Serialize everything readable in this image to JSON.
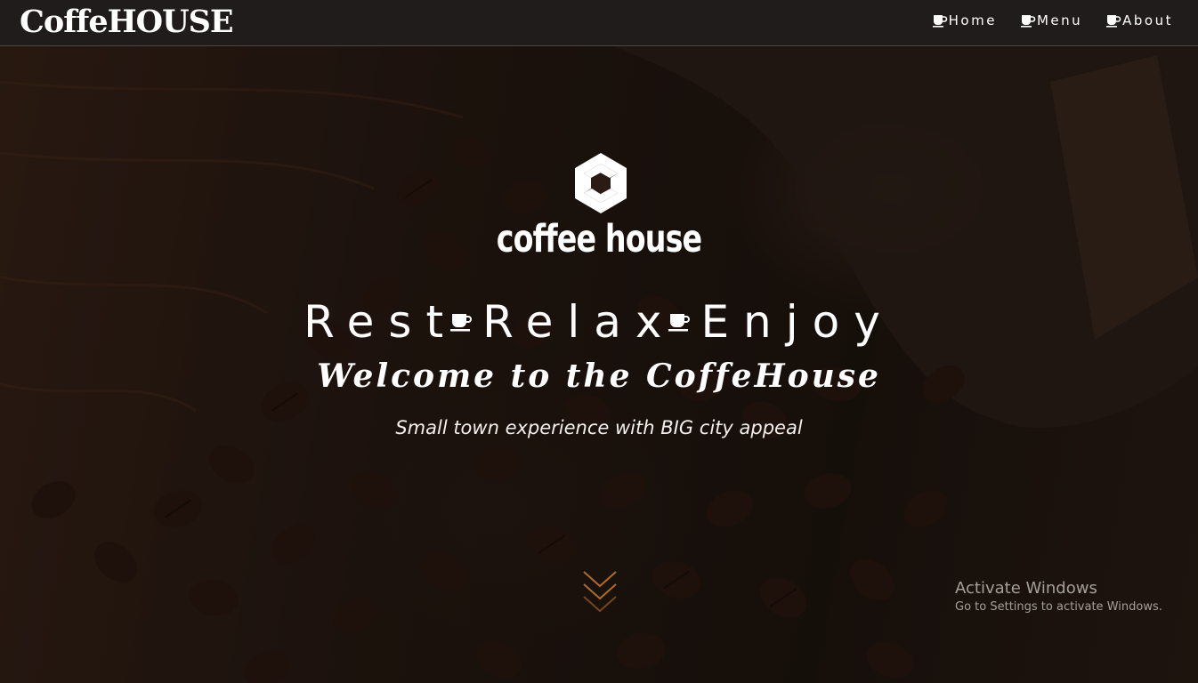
{
  "navbar": {
    "brand": "CoffeHOUSE",
    "links": [
      {
        "label": "Home",
        "icon": "coffee-cup-icon"
      },
      {
        "label": "Menu",
        "icon": "coffee-cup-icon"
      },
      {
        "label": "About",
        "icon": "coffee-cup-icon"
      }
    ]
  },
  "hero": {
    "logo_text": "coffee house",
    "tagline": [
      "Rest",
      "Relax",
      "Enjoy"
    ],
    "welcome": "Welcome to the CoffeHouse",
    "subtitle": "Small town experience with BIG city appeal",
    "scroll_icon": "chevron-down-icon"
  },
  "watermark": {
    "title": "Activate Windows",
    "subtitle": "Go to Settings to activate Windows."
  },
  "colors": {
    "navbar_bg": "#201c1b",
    "text": "#ffffff",
    "accent_chevron": "#b06a2c"
  }
}
